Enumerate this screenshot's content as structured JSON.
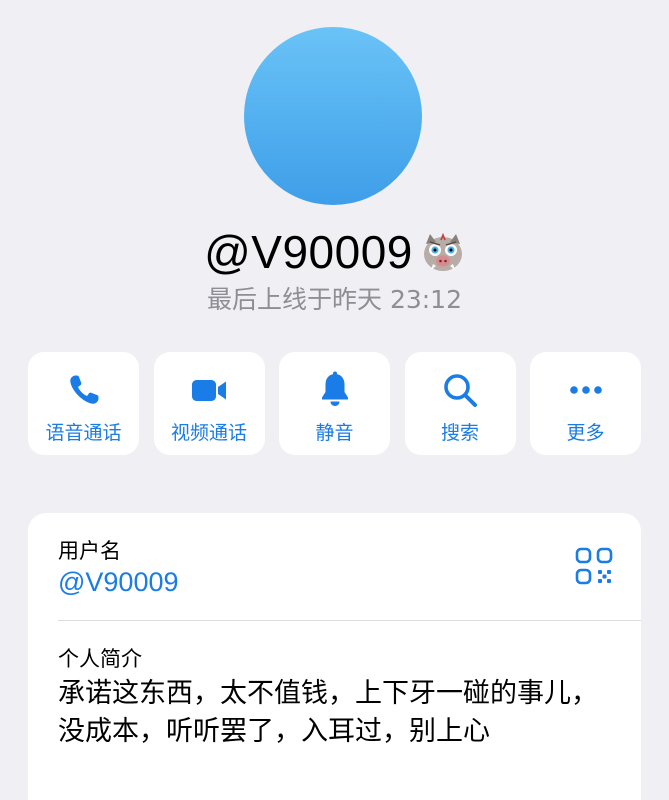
{
  "profile": {
    "display_name": "@V90009",
    "emoji": "boar-mask-emoji",
    "last_seen": "最后上线于昨天 23:12",
    "avatar_color": "#4aa9ee"
  },
  "actions": [
    {
      "label": "语音通话",
      "icon": "phone-icon"
    },
    {
      "label": "视频通话",
      "icon": "video-camera-icon"
    },
    {
      "label": "静音",
      "icon": "bell-icon"
    },
    {
      "label": "搜索",
      "icon": "search-icon"
    },
    {
      "label": "更多",
      "icon": "more-dots-icon"
    }
  ],
  "info": {
    "username_label": "用户名",
    "username_value": "@V90009",
    "bio_label": "个人简介",
    "bio_text": "承诺这东西，太不值钱，上下牙一碰的事儿，没成本，听听罢了，入耳过，别上心"
  },
  "colors": {
    "accent": "#1a7ce6",
    "background": "#efeff4",
    "secondary_text": "#8e8e93"
  }
}
